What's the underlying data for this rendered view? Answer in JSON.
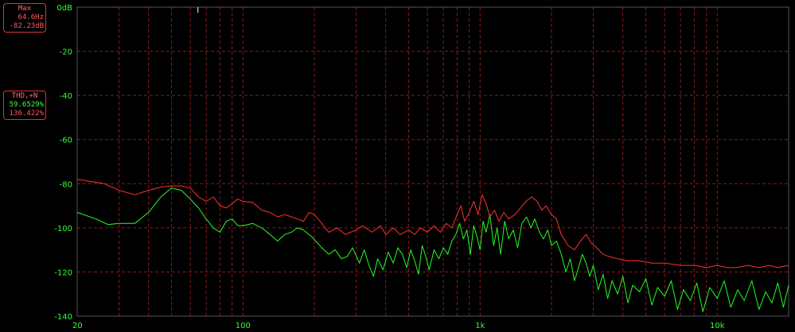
{
  "max_panel": {
    "title": "Max",
    "freq": "64.6Hz",
    "level": "-82.23dB"
  },
  "thd_panel": {
    "title": "THD,+N",
    "value1": "59.6529%",
    "value2": "136.422%"
  },
  "chart_data": {
    "type": "line",
    "x_scale": "log",
    "xlim": [
      20,
      20000
    ],
    "ylim": [
      -140,
      0
    ],
    "x_ticks": [
      {
        "v": 20,
        "label": "20"
      },
      {
        "v": 100,
        "label": "100"
      },
      {
        "v": 1000,
        "label": "1k"
      },
      {
        "v": 10000,
        "label": "10k"
      }
    ],
    "y_ticks": [
      {
        "v": 0,
        "label": "0dB"
      },
      {
        "v": -20,
        "label": "-20"
      },
      {
        "v": -40,
        "label": "-40"
      },
      {
        "v": -60,
        "label": "-60"
      },
      {
        "v": -80,
        "label": "-80"
      },
      {
        "v": -100,
        "label": "-100"
      },
      {
        "v": -120,
        "label": "-120"
      },
      {
        "v": -140,
        "label": "-140"
      }
    ],
    "grid": true,
    "colors": {
      "background": "#000000",
      "grid": "#8b1a1a",
      "axis_text": "#33ff33",
      "red_series": "#ff3030",
      "green_series": "#22ff22"
    },
    "series": [
      {
        "color": "red",
        "points": [
          [
            20,
            -78
          ],
          [
            26,
            -80
          ],
          [
            30,
            -83
          ],
          [
            35,
            -85
          ],
          [
            40,
            -83
          ],
          [
            45,
            -81.5
          ],
          [
            50,
            -81
          ],
          [
            55,
            -81
          ],
          [
            60,
            -82
          ],
          [
            65,
            -86
          ],
          [
            70,
            -88
          ],
          [
            75,
            -86
          ],
          [
            80,
            -90
          ],
          [
            85,
            -91
          ],
          [
            90,
            -89
          ],
          [
            95,
            -87
          ],
          [
            100,
            -88
          ],
          [
            110,
            -88.5
          ],
          [
            120,
            -92
          ],
          [
            130,
            -93
          ],
          [
            140,
            -95
          ],
          [
            150,
            -94
          ],
          [
            160,
            -95
          ],
          [
            170,
            -96
          ],
          [
            180,
            -97
          ],
          [
            190,
            -93
          ],
          [
            200,
            -94
          ],
          [
            215,
            -98
          ],
          [
            230,
            -102
          ],
          [
            250,
            -100
          ],
          [
            270,
            -103
          ],
          [
            300,
            -101
          ],
          [
            320,
            -99
          ],
          [
            350,
            -102
          ],
          [
            380,
            -99
          ],
          [
            400,
            -103
          ],
          [
            430,
            -100
          ],
          [
            460,
            -103
          ],
          [
            500,
            -101
          ],
          [
            530,
            -103
          ],
          [
            560,
            -100
          ],
          [
            600,
            -102
          ],
          [
            640,
            -99
          ],
          [
            680,
            -102
          ],
          [
            720,
            -98
          ],
          [
            760,
            -100
          ],
          [
            800,
            -94
          ],
          [
            830,
            -90
          ],
          [
            860,
            -97
          ],
          [
            900,
            -93
          ],
          [
            940,
            -88
          ],
          [
            980,
            -94
          ],
          [
            1020,
            -85
          ],
          [
            1060,
            -89
          ],
          [
            1100,
            -95
          ],
          [
            1150,
            -92
          ],
          [
            1200,
            -97
          ],
          [
            1260,
            -93
          ],
          [
            1320,
            -96
          ],
          [
            1400,
            -94
          ],
          [
            1480,
            -91
          ],
          [
            1560,
            -88
          ],
          [
            1650,
            -86
          ],
          [
            1740,
            -88
          ],
          [
            1820,
            -92
          ],
          [
            1900,
            -90
          ],
          [
            2000,
            -94
          ],
          [
            2100,
            -96
          ],
          [
            2200,
            -103
          ],
          [
            2350,
            -108
          ],
          [
            2500,
            -110
          ],
          [
            2650,
            -106
          ],
          [
            2800,
            -103
          ],
          [
            2950,
            -107
          ],
          [
            3100,
            -109
          ],
          [
            3300,
            -112
          ],
          [
            3500,
            -113
          ],
          [
            3800,
            -114
          ],
          [
            4200,
            -115
          ],
          [
            4700,
            -115
          ],
          [
            5300,
            -116
          ],
          [
            6000,
            -116
          ],
          [
            7000,
            -117
          ],
          [
            8000,
            -117
          ],
          [
            9000,
            -118
          ],
          [
            10000,
            -117
          ],
          [
            11000,
            -118
          ],
          [
            12000,
            -118
          ],
          [
            13500,
            -117
          ],
          [
            15000,
            -118
          ],
          [
            16500,
            -117
          ],
          [
            18000,
            -118
          ],
          [
            20000,
            -117
          ]
        ]
      },
      {
        "color": "green",
        "points": [
          [
            20,
            -93
          ],
          [
            24,
            -96
          ],
          [
            27,
            -98.5
          ],
          [
            30,
            -98
          ],
          [
            35,
            -98
          ],
          [
            40,
            -93
          ],
          [
            45,
            -86
          ],
          [
            50,
            -82
          ],
          [
            55,
            -83
          ],
          [
            60,
            -87
          ],
          [
            65,
            -91
          ],
          [
            70,
            -96
          ],
          [
            75,
            -100
          ],
          [
            80,
            -102
          ],
          [
            85,
            -97
          ],
          [
            90,
            -96
          ],
          [
            95,
            -99
          ],
          [
            100,
            -99
          ],
          [
            110,
            -98
          ],
          [
            120,
            -100
          ],
          [
            130,
            -103
          ],
          [
            140,
            -106
          ],
          [
            150,
            -103
          ],
          [
            160,
            -102
          ],
          [
            170,
            -100
          ],
          [
            180,
            -101
          ],
          [
            195,
            -104
          ],
          [
            215,
            -109
          ],
          [
            230,
            -112
          ],
          [
            245,
            -110
          ],
          [
            260,
            -114
          ],
          [
            275,
            -113
          ],
          [
            290,
            -109
          ],
          [
            310,
            -116
          ],
          [
            325,
            -110
          ],
          [
            340,
            -117
          ],
          [
            355,
            -122
          ],
          [
            370,
            -114
          ],
          [
            390,
            -119
          ],
          [
            410,
            -111
          ],
          [
            430,
            -116
          ],
          [
            450,
            -109
          ],
          [
            470,
            -112
          ],
          [
            490,
            -118
          ],
          [
            510,
            -110
          ],
          [
            530,
            -115
          ],
          [
            550,
            -121
          ],
          [
            570,
            -108
          ],
          [
            590,
            -113
          ],
          [
            610,
            -119
          ],
          [
            640,
            -110
          ],
          [
            670,
            -114
          ],
          [
            700,
            -109
          ],
          [
            730,
            -112
          ],
          [
            760,
            -106
          ],
          [
            790,
            -103
          ],
          [
            820,
            -98
          ],
          [
            850,
            -105
          ],
          [
            880,
            -101
          ],
          [
            910,
            -112
          ],
          [
            940,
            -99
          ],
          [
            970,
            -104
          ],
          [
            1000,
            -110
          ],
          [
            1030,
            -97
          ],
          [
            1060,
            -102
          ],
          [
            1100,
            -94
          ],
          [
            1140,
            -108
          ],
          [
            1180,
            -100
          ],
          [
            1220,
            -112
          ],
          [
            1270,
            -97
          ],
          [
            1320,
            -105
          ],
          [
            1380,
            -101
          ],
          [
            1440,
            -109
          ],
          [
            1500,
            -98
          ],
          [
            1570,
            -95
          ],
          [
            1640,
            -100
          ],
          [
            1700,
            -96
          ],
          [
            1780,
            -102
          ],
          [
            1850,
            -105
          ],
          [
            1930,
            -101
          ],
          [
            2000,
            -108
          ],
          [
            2100,
            -106
          ],
          [
            2200,
            -112
          ],
          [
            2300,
            -120
          ],
          [
            2400,
            -114
          ],
          [
            2500,
            -124
          ],
          [
            2600,
            -118
          ],
          [
            2700,
            -112
          ],
          [
            2800,
            -116
          ],
          [
            2900,
            -122
          ],
          [
            3000,
            -117
          ],
          [
            3150,
            -128
          ],
          [
            3300,
            -121
          ],
          [
            3450,
            -132
          ],
          [
            3600,
            -124
          ],
          [
            3800,
            -130
          ],
          [
            4000,
            -122
          ],
          [
            4200,
            -134
          ],
          [
            4400,
            -126
          ],
          [
            4700,
            -129
          ],
          [
            5000,
            -123
          ],
          [
            5300,
            -135
          ],
          [
            5600,
            -127
          ],
          [
            6000,
            -131
          ],
          [
            6400,
            -124
          ],
          [
            6800,
            -137
          ],
          [
            7200,
            -128
          ],
          [
            7700,
            -133
          ],
          [
            8200,
            -125
          ],
          [
            8700,
            -138
          ],
          [
            9300,
            -127
          ],
          [
            10000,
            -132
          ],
          [
            10700,
            -124
          ],
          [
            11400,
            -136
          ],
          [
            12200,
            -128
          ],
          [
            13000,
            -133
          ],
          [
            14000,
            -124
          ],
          [
            15000,
            -137
          ],
          [
            16000,
            -129
          ],
          [
            17000,
            -134
          ],
          [
            18000,
            -125
          ],
          [
            19000,
            -136
          ],
          [
            20000,
            -126
          ]
        ]
      }
    ]
  }
}
